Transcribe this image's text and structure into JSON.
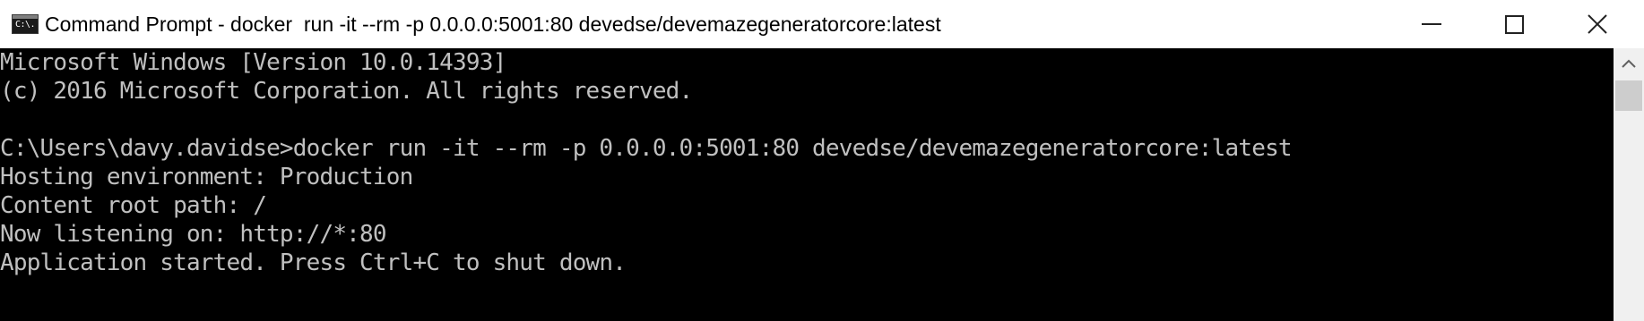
{
  "window": {
    "title": "Command Prompt - docker  run -it --rm -p 0.0.0.0:5001:80 devedse/devemazegeneratorcore:latest",
    "app_icon_text": "C:\\."
  },
  "controls": {
    "minimize": "minimize-icon",
    "maximize": "maximize-icon",
    "close": "close-icon"
  },
  "console": {
    "background": "#000000",
    "foreground": "#c0c0c0",
    "lines": [
      "Microsoft Windows [Version 10.0.14393]",
      "(c) 2016 Microsoft Corporation. All rights reserved.",
      "",
      "C:\\Users\\davy.davidse>docker run -it --rm -p 0.0.0.0:5001:80 devedse/devemazegeneratorcore:latest",
      "Hosting environment: Production",
      "Content root path: /",
      "Now listening on: http://*:80",
      "Application started. Press Ctrl+C to shut down."
    ]
  }
}
